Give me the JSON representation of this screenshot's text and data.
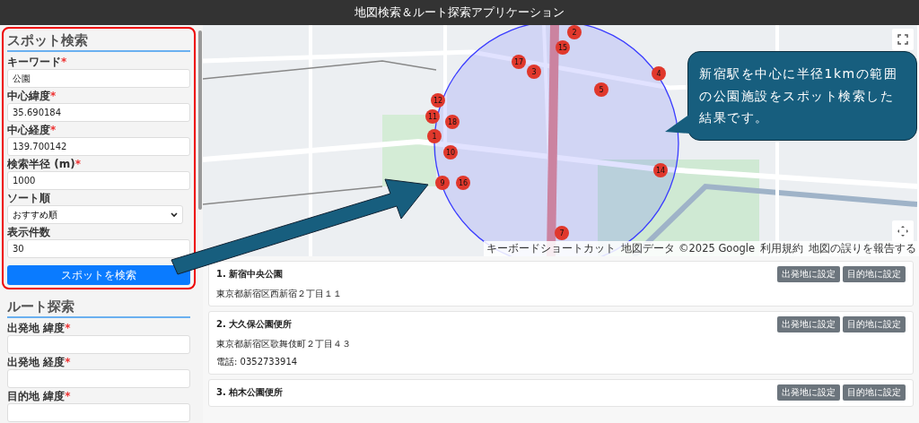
{
  "window": {
    "title": "地図検索＆ルート探索アプリケーション"
  },
  "spot_search": {
    "heading": "スポット検索",
    "highlighted": true,
    "fields": [
      {
        "kind": "text",
        "label": "キーワード",
        "required_mark": "*",
        "value": "公園"
      },
      {
        "kind": "text",
        "label": "中心緯度",
        "required_mark": "*",
        "value": "35.690184"
      },
      {
        "kind": "text",
        "label": "中心経度",
        "required_mark": "*",
        "value": "139.700142"
      },
      {
        "kind": "text",
        "label": "検索半径 (m)",
        "required_mark": "*",
        "value": "1000"
      },
      {
        "kind": "select",
        "label": "ソート順",
        "value": "おすすめ順"
      },
      {
        "kind": "text",
        "label": "表示件数",
        "value": "30"
      }
    ],
    "button": "スポットを検索"
  },
  "route_search": {
    "heading": "ルート探索",
    "fields": [
      {
        "kind": "text",
        "label": "出発地 緯度",
        "required_mark": "*"
      },
      {
        "kind": "text",
        "label": "出発地 経度",
        "required_mark": "*"
      },
      {
        "kind": "text",
        "label": "目的地 緯度",
        "required_mark": "*"
      }
    ]
  },
  "map": {
    "markers": [
      "2",
      "15",
      "17",
      "3",
      "4",
      "5",
      "12",
      "11",
      "18",
      "1",
      "10",
      "9",
      "16",
      "14",
      "7"
    ],
    "attribution": [
      "キーボードショートカット",
      "地図データ ©2025 Google",
      "利用規約",
      "地図の誤りを報告する"
    ]
  },
  "callout": {
    "text": "新宿駅を中心に半径1kmの範囲の公園施設をスポット検索した結果です。"
  },
  "results": [
    {
      "title": "1. 新宿中央公園",
      "address": "東京都新宿区西新宿２丁目１１",
      "buttons": [
        "出発地に設定",
        "目的地に設定"
      ]
    },
    {
      "title": "2. 大久保公園便所",
      "address": "東京都新宿区歌舞伎町２丁目４３",
      "phone": "電話: 0352733914",
      "buttons": [
        "出発地に設定",
        "目的地に設定"
      ]
    },
    {
      "title": "3. 柏木公園便所",
      "buttons": [
        "出発地に設定",
        "目的地に設定"
      ]
    }
  ]
}
